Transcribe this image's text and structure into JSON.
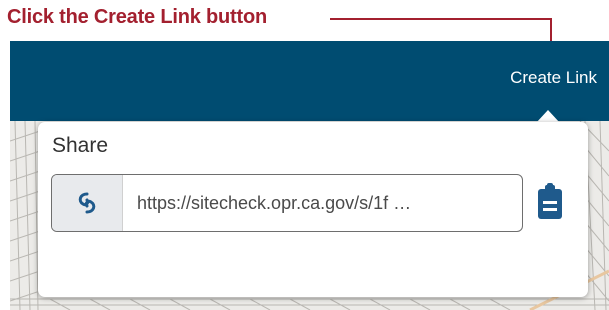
{
  "callout": {
    "text": "Click the Create Link button",
    "color": "#a3202f"
  },
  "header": {
    "create_link_label": "Create Link",
    "color": "#004c71"
  },
  "share_panel": {
    "title": "Share",
    "link_icon": "link-icon",
    "url": "https://sitecheck.opr.ca.gov/s/1f …",
    "copy_icon": "clipboard-icon",
    "accent": "#1f5a8c"
  }
}
